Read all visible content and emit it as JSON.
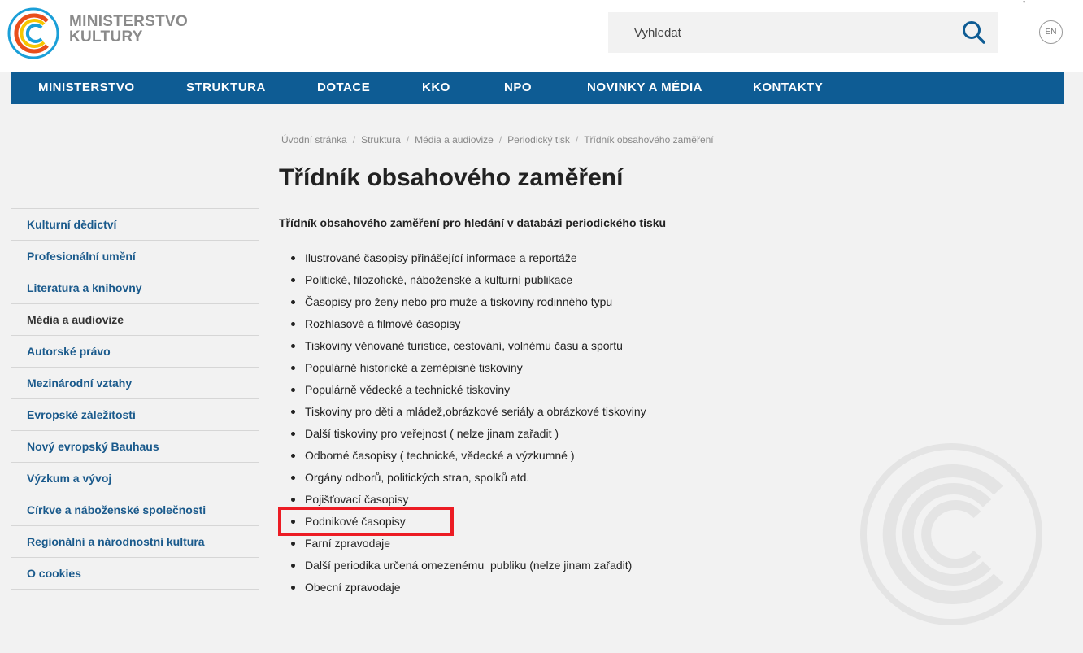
{
  "header": {
    "logo_line1": "MINISTERSTVO",
    "logo_line2": "KULTURY",
    "search_placeholder": "Vyhledat",
    "lang_label": "EN"
  },
  "nav": {
    "items": [
      {
        "label": "MINISTERSTVO"
      },
      {
        "label": "STRUKTURA"
      },
      {
        "label": "DOTACE"
      },
      {
        "label": "KKO"
      },
      {
        "label": "NPO"
      },
      {
        "label": "NOVINKY A MÉDIA"
      },
      {
        "label": "KONTAKTY"
      }
    ]
  },
  "sidebar": {
    "items": [
      {
        "label": "Kulturní dědictví"
      },
      {
        "label": "Profesionální umění"
      },
      {
        "label": "Literatura a knihovny"
      },
      {
        "label": "Média a audiovize",
        "active": true
      },
      {
        "label": "Autorské právo"
      },
      {
        "label": "Mezinárodní vztahy"
      },
      {
        "label": "Evropské záležitosti"
      },
      {
        "label": "Nový evropský Bauhaus"
      },
      {
        "label": "Výzkum a vývoj"
      },
      {
        "label": "Církve a náboženské společnosti"
      },
      {
        "label": "Regionální a národnostní kultura"
      },
      {
        "label": "O cookies"
      }
    ]
  },
  "breadcrumb": [
    "Úvodní stránka",
    "Struktura",
    "Média a audiovize",
    "Periodický tisk",
    "Třídník obsahového zaměření"
  ],
  "main": {
    "title": "Třídník obsahového zaměření",
    "intro": "Třídník obsahového zaměření pro hledání v databázi periodického tisku",
    "list": [
      "Ilustrované časopisy přinášející informace a reportáže",
      "Politické, filozofické, náboženské a kulturní publikace",
      "Časopisy pro ženy nebo pro muže a tiskoviny rodinného typu",
      "Rozhlasové a filmové časopisy",
      "Tiskoviny věnované turistice, cestování, volnému času a sportu",
      "Populárně historické a zeměpisné tiskoviny",
      "Populárně vědecké a technické tiskoviny",
      "Tiskoviny pro děti a mládež,obrázkové seriály a obrázkové tiskoviny",
      "Další tiskoviny pro veřejnost ( nelze jinam zařadit )",
      "Odborné časopisy ( technické, vědecké a výzkumné )",
      "Orgány odborů, politických stran, spolků atd.",
      "Pojišťovací časopisy",
      "Podnikové časopisy",
      "Farní zpravodaje",
      "Další periodika určená omezenému  publiku (nelze jinam zařadit)",
      "Obecní zpravodaje"
    ]
  },
  "colors": {
    "nav_bg": "#0e5c94",
    "link": "#1a5a8c",
    "highlight": "#ec1c24",
    "page_bg": "#f2f2f2"
  }
}
